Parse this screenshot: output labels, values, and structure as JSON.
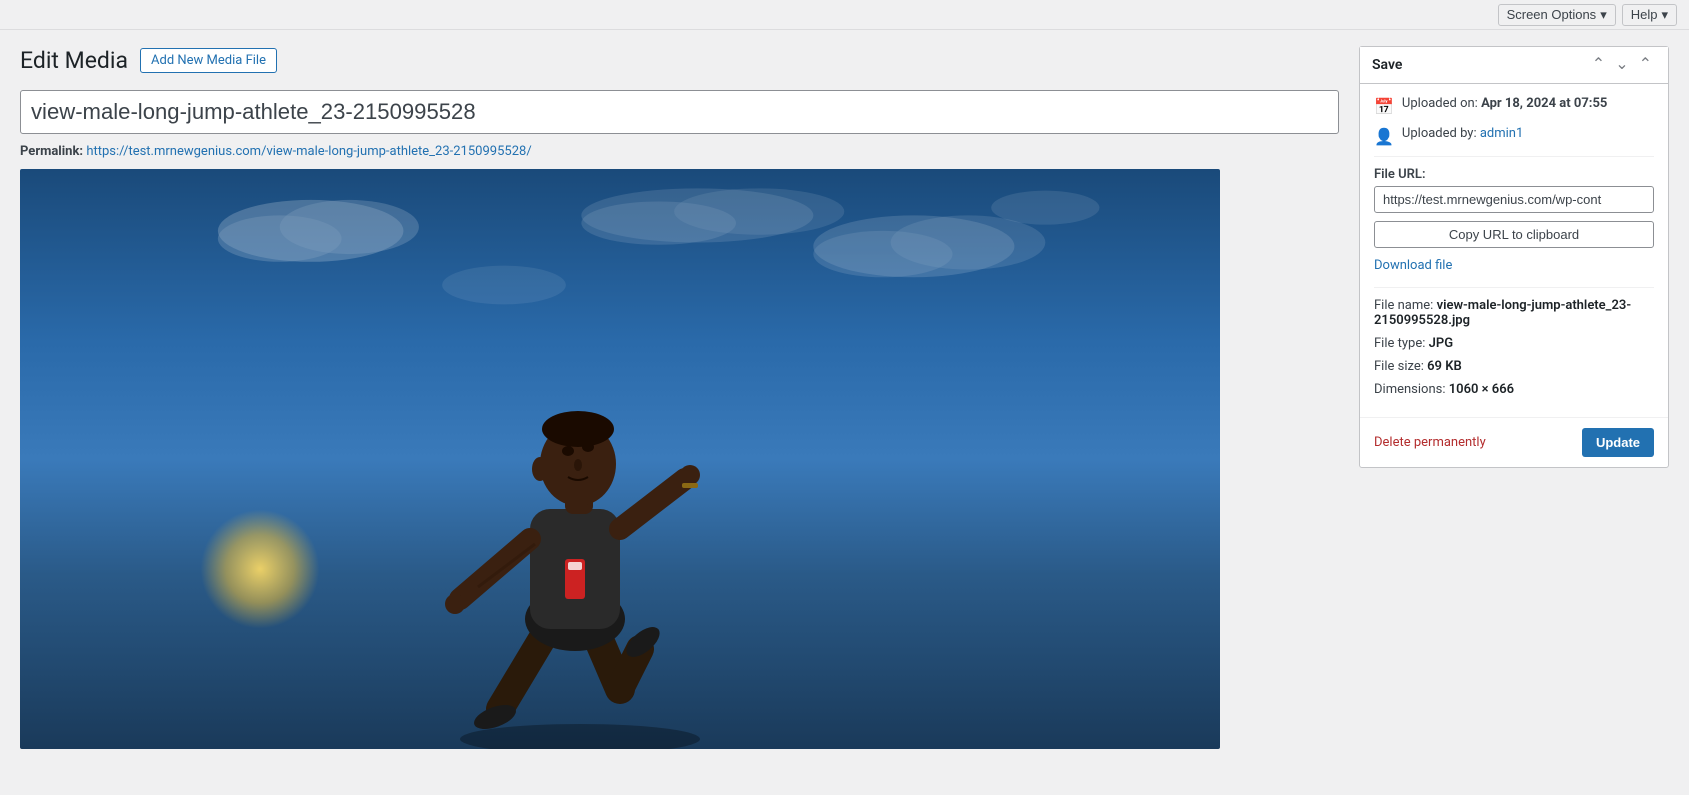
{
  "topbar": {
    "screen_options_label": "Screen Options",
    "help_label": "Help"
  },
  "header": {
    "page_title": "Edit Media",
    "add_new_label": "Add New Media File"
  },
  "title_field": {
    "value": "view-male-long-jump-athlete_23-2150995528"
  },
  "permalink": {
    "label": "Permalink:",
    "url": "https://test.mrnewgenius.com/view-male-long-jump-athlete_23-2150995528/"
  },
  "sidebar": {
    "save_title": "Save",
    "uploaded_on_label": "Uploaded on:",
    "uploaded_on_value": "Apr 18, 2024 at 07:55",
    "uploaded_by_label": "Uploaded by:",
    "uploaded_by_user": "admin1",
    "file_url_label": "File URL:",
    "file_url_value": "https://test.mrnewgenius.com/wp-cont",
    "copy_url_label": "Copy URL to clipboard",
    "download_label": "Download file",
    "file_name_label": "File name:",
    "file_name_value": "view-male-long-jump-athlete_23-2150995528.jpg",
    "file_type_label": "File type:",
    "file_type_value": "JPG",
    "file_size_label": "File size:",
    "file_size_value": "69 KB",
    "dimensions_label": "Dimensions:",
    "dimensions_value": "1060 × 666",
    "delete_label": "Delete permanently",
    "update_label": "Update"
  }
}
